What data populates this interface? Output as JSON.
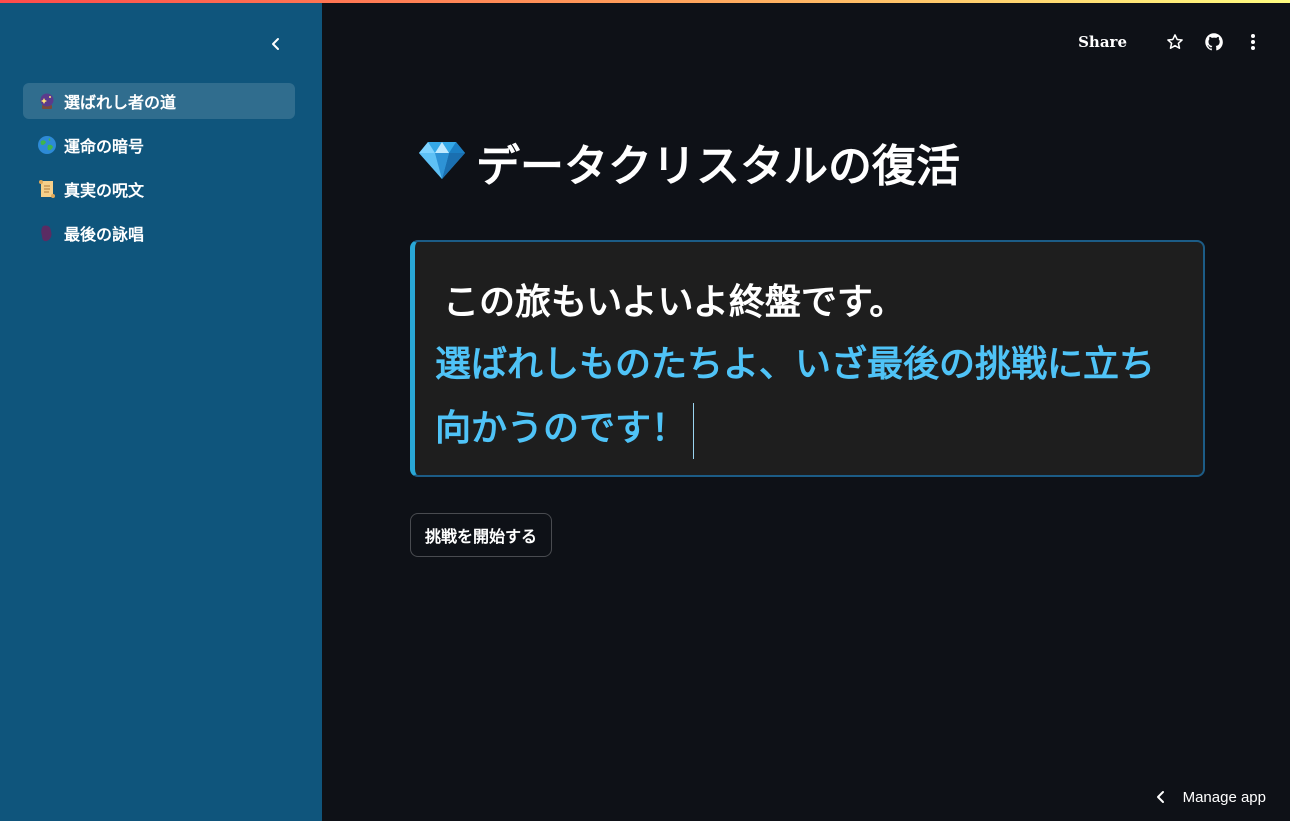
{
  "header": {
    "share_label": "Share",
    "icons": [
      "star-icon",
      "github-icon",
      "more-vertical-icon"
    ]
  },
  "sidebar": {
    "collapse_icon": "chevron-left-icon",
    "items": [
      {
        "label": "選ばれし者の道",
        "icon": "crystal-ball-icon",
        "active": true
      },
      {
        "label": "運命の暗号",
        "icon": "globe-icon",
        "active": false
      },
      {
        "label": "真実の呪文",
        "icon": "scroll-icon",
        "active": false
      },
      {
        "label": "最後の詠唱",
        "icon": "purple-blob-icon",
        "active": false
      }
    ]
  },
  "main": {
    "title_icon": "gem-icon",
    "title": "データクリスタルの復活",
    "message": {
      "line1": "この旅もいよいよ終盤です。",
      "line2": "選ばれしものたちよ、いざ最後の挑戦に立ち向かうのです！"
    },
    "start_button": "挑戦を開始する"
  },
  "footer": {
    "manage_app_label": "Manage app",
    "manage_icon": "chevron-left-icon"
  },
  "colors": {
    "sidebar_bg": "#0f557c",
    "main_bg": "#0e1117",
    "accent": "#4fc3f7",
    "box_bg": "#1e1e1e"
  }
}
